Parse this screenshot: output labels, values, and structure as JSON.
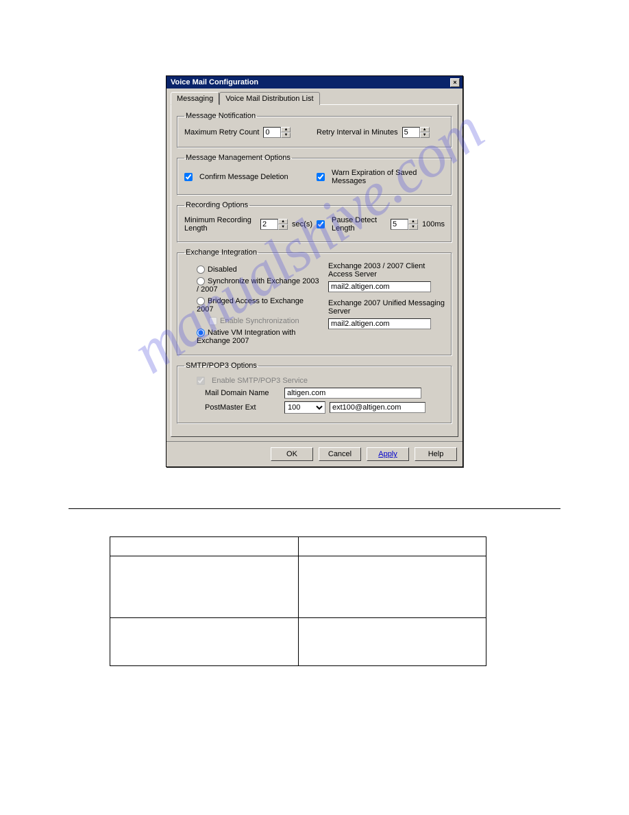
{
  "titlebar": {
    "text": "Voice Mail Configuration",
    "close": "×"
  },
  "tabs": {
    "active": "Messaging",
    "inactive": "Voice Mail Distribution List"
  },
  "notification": {
    "legend": "Message Notification",
    "retry_label": "Maximum Retry Count",
    "retry_val": "0",
    "interval_label": "Retry Interval in Minutes",
    "interval_val": "5"
  },
  "mgmt": {
    "legend": "Message Management Options",
    "confirm": "Confirm Message Deletion",
    "warn": "Warn Expiration of Saved Messages"
  },
  "rec": {
    "legend": "Recording Options",
    "minlen_label": "Minimum Recording Length",
    "minlen_val": "2",
    "minlen_unit": "sec(s)",
    "pause_label": "Pause Detect Length",
    "pause_val": "5",
    "pause_unit": "100ms"
  },
  "ex": {
    "legend": "Exchange Integration",
    "opt1": "Disabled",
    "opt2": "Synchronize with Exchange 2003 / 2007",
    "opt3": "Bridged Access to Exchange 2007",
    "opt3sub": "Enable Synchronization",
    "opt4": "Native VM Integration with Exchange 2007",
    "srv1_label": "Exchange 2003 / 2007 Client Access Server",
    "srv1_val": "mail2.altigen.com",
    "srv2_label": "Exchange 2007 Unified Messaging Server",
    "srv2_val": "mail2.altigen.com"
  },
  "smtp": {
    "legend": "SMTP/POP3 Options",
    "enable": "Enable SMTP/POP3 Service",
    "domain_label": "Mail Domain Name",
    "domain_val": "altigen.com",
    "pm_label": "PostMaster Ext",
    "pm_val": "100",
    "pm_email": "ext100@altigen.com"
  },
  "buttons": {
    "ok": "OK",
    "cancel": "Cancel",
    "apply": "Apply",
    "help": "Help"
  },
  "watermark": "manualshive.com"
}
